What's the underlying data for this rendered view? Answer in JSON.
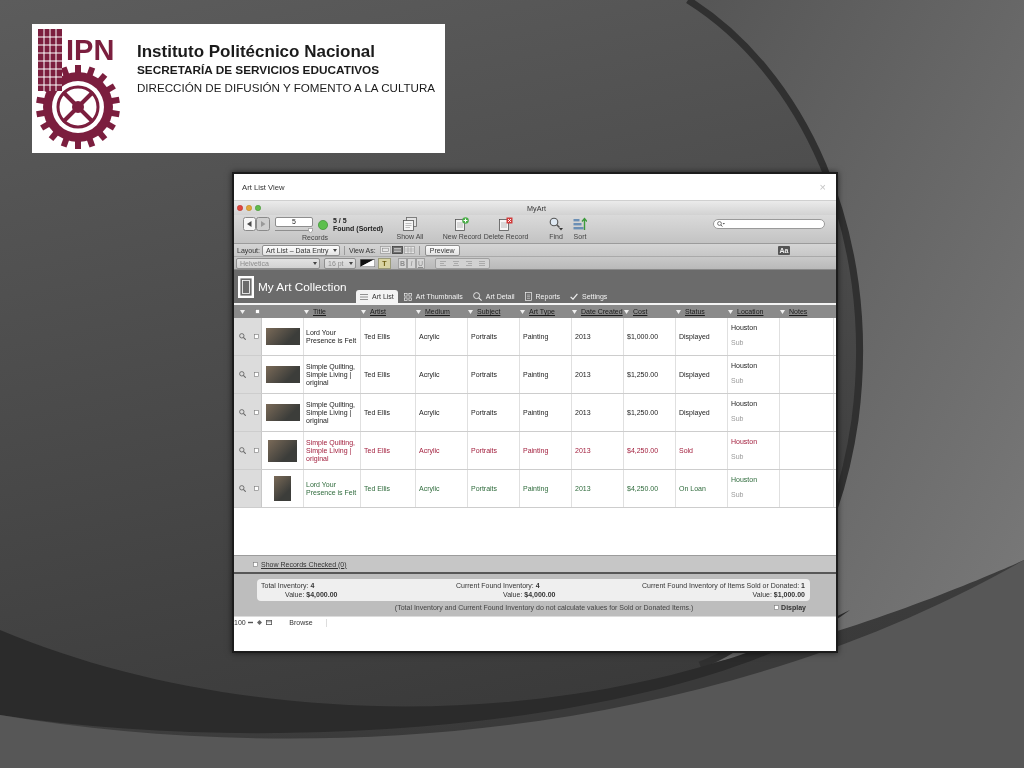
{
  "logo": {
    "emblem_text": "IPN",
    "lines": [
      "Instituto Politécnico Nacional",
      "SECRETARÍA DE SERVICIOS EDUCATIVOS",
      "DIRECCIÓN DE DIFUSIÓN Y FOMENTO A LA CULTURA"
    ]
  },
  "dialog": {
    "title": "Art List View",
    "close": "×"
  },
  "app_window": {
    "title": "MyArt"
  },
  "toolbar": {
    "record_number": "5",
    "record_slider": {
      "level": 1
    },
    "found_count": "5 / 5",
    "found_status": "Found (Sorted)",
    "records_label": "Records",
    "buttons": [
      {
        "kind": "show_all",
        "label": "Show All"
      },
      {
        "kind": "new_record",
        "label": "New Record"
      },
      {
        "kind": "delete_record",
        "label": "Delete Record"
      },
      {
        "kind": "find",
        "label": "Find"
      },
      {
        "kind": "sort",
        "label": "Sort"
      }
    ]
  },
  "layout_bar": {
    "layout_label": "Layout:",
    "layout": "Art List – Data Entry",
    "view_as_label": "View As:",
    "view_modes": [
      {
        "kind": "form",
        "selected": false
      },
      {
        "kind": "list",
        "selected": true
      },
      {
        "kind": "table",
        "selected": false
      }
    ],
    "preview": "Preview",
    "format_toggle": "Aa"
  },
  "format_bar": {
    "disabled": true,
    "font": "Helvetica",
    "size": "16 pt",
    "highlight": "T",
    "styles": [
      "B",
      "I",
      "U"
    ]
  },
  "header": {
    "title": "My Art Collection",
    "tabs": [
      {
        "label": "Art List",
        "kind": "list",
        "selected": true
      },
      {
        "label": "Art Thumbnails",
        "kind": "thumbnails",
        "selected": false
      },
      {
        "label": "Art Detail",
        "kind": "detail",
        "selected": false
      },
      {
        "label": "Reports",
        "kind": "reports",
        "selected": false
      },
      {
        "label": "Settings",
        "kind": "settings",
        "selected": false
      }
    ]
  },
  "table": {
    "all_checked": false,
    "columns": [
      "Title",
      "Artist",
      "Medium",
      "Subject",
      "Art Type",
      "Date Created",
      "Cost",
      "Status",
      "Location",
      "Notes"
    ],
    "rows": [
      {
        "kind": "displayed",
        "checked": false,
        "thumbnail": {
          "kind": "wide"
        },
        "title": "Lord Your Presence is Felt",
        "artist": "Ted Ellis",
        "medium": "Acrylic",
        "subject": "Portraits",
        "art_type": "Painting",
        "date_created": "2013",
        "cost": "$1,000.00",
        "status": "Displayed",
        "location": "Houston",
        "location_note": "Sub"
      },
      {
        "kind": "displayed",
        "checked": false,
        "thumbnail": {
          "kind": "wide"
        },
        "title": "Simple Quilting, Simple Living | original",
        "artist": "Ted Ellis",
        "medium": "Acrylic",
        "subject": "Portraits",
        "art_type": "Painting",
        "date_created": "2013",
        "cost": "$1,250.00",
        "status": "Displayed",
        "location": "Houston",
        "location_note": "Sub"
      },
      {
        "kind": "displayed",
        "checked": false,
        "thumbnail": {
          "kind": "wide"
        },
        "title": "Simple Quilting, Simple Living | original",
        "artist": "Ted Ellis",
        "medium": "Acrylic",
        "subject": "Portraits",
        "art_type": "Painting",
        "date_created": "2013",
        "cost": "$1,250.00",
        "status": "Displayed",
        "location": "Houston",
        "location_note": "Sub"
      },
      {
        "kind": "sold",
        "checked": false,
        "thumbnail": {
          "kind": "landscape"
        },
        "title": "Simple Quilting, Simple Living | original",
        "artist": "Ted Ellis",
        "medium": "Acrylic",
        "subject": "Portraits",
        "art_type": "Painting",
        "date_created": "2013",
        "cost": "$4,250.00",
        "status": "Sold",
        "location": "Houston",
        "location_note": "Sub"
      },
      {
        "kind": "on_loan",
        "checked": false,
        "thumbnail": {
          "kind": "portrait"
        },
        "title": "Lord Your Presence is Felt",
        "artist": "Ted Ellis",
        "medium": "Acrylic",
        "subject": "Portraits",
        "art_type": "Painting",
        "date_created": "2013",
        "cost": "$4,250.00",
        "status": "On Loan",
        "location": "Houston",
        "location_note": "Sub"
      }
    ]
  },
  "footer": {
    "show_checked": {
      "label": "Show Records Checked (0)",
      "checked": false
    },
    "summary": [
      {
        "count": "Total Inventory: **4**",
        "value": "Value: **$4,000.00**"
      },
      {
        "count": "Current Found Inventory: **4**",
        "value": "Value: **$4,000.00**"
      },
      {
        "count": "Current Found Inventory of Items Sold or Donated: **1**",
        "value": "Value: **$1,000.00**"
      }
    ],
    "note": "(Total Inventory and Current Found Inventory do not calculate values for Sold or Donated Items.)",
    "display": {
      "label": "Display",
      "checked": false
    }
  },
  "status_bar": {
    "zoom": "100",
    "mode": "Browse"
  }
}
